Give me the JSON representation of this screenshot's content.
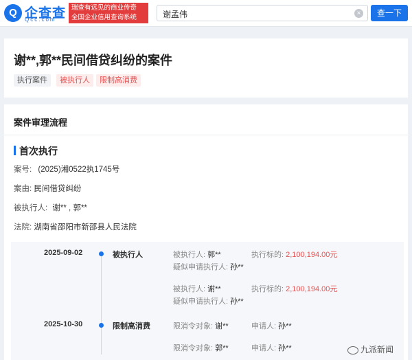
{
  "header": {
    "logo_mark": "Q",
    "logo_text": "企查查",
    "logo_sub": "Qcc.com",
    "slogan_line1": "瑞查有远见的商业传奇",
    "slogan_line2": "全国企业信用查询系统",
    "search_value": "谢孟伟",
    "search_button": "查一下"
  },
  "case": {
    "title": "谢**,郭**民间借贷纠纷的案件",
    "tags": [
      "执行案件",
      "被执行人",
      "限制高消费"
    ]
  },
  "process": {
    "section_title": "案件审理流程",
    "stage_title": "首次执行",
    "case_no_label": "案号:",
    "case_no": "(2025)湘0522执1745号",
    "cause_label": "案由:",
    "cause": "民间借贷纠纷",
    "executed_label": "被执行人:",
    "executed": "谢** , 郭**",
    "court_label": "法院:",
    "court": "湖南省邵阳市新邵县人民法院"
  },
  "timeline": [
    {
      "date": "2025-09-02",
      "type": "被执行人",
      "entries": [
        {
          "person_label": "被执行人:",
          "person": "郭**",
          "amount_label": "执行标的:",
          "amount": "2,100,194.00元",
          "applicant_label": "疑似申请执行人:",
          "applicant": "孙**"
        },
        {
          "person_label": "被执行人:",
          "person": "谢**",
          "amount_label": "执行标的:",
          "amount": "2,100,194.00元",
          "applicant_label": "疑似申请执行人:",
          "applicant": "孙**"
        }
      ]
    },
    {
      "date": "2025-10-30",
      "type": "限制高消费",
      "entries": [
        {
          "target_label": "限消令对象:",
          "target": "谢**",
          "applicant_label": "申请人:",
          "applicant": "孙**"
        },
        {
          "target_label": "限消令对象:",
          "target": "郭**",
          "applicant_label": "申请人:",
          "applicant": "孙**"
        }
      ]
    }
  ],
  "watermark": "九派新闻",
  "colors": {
    "brand": "#1a73e8",
    "danger": "#e55353",
    "slogan_bg": "#e23c3c"
  }
}
